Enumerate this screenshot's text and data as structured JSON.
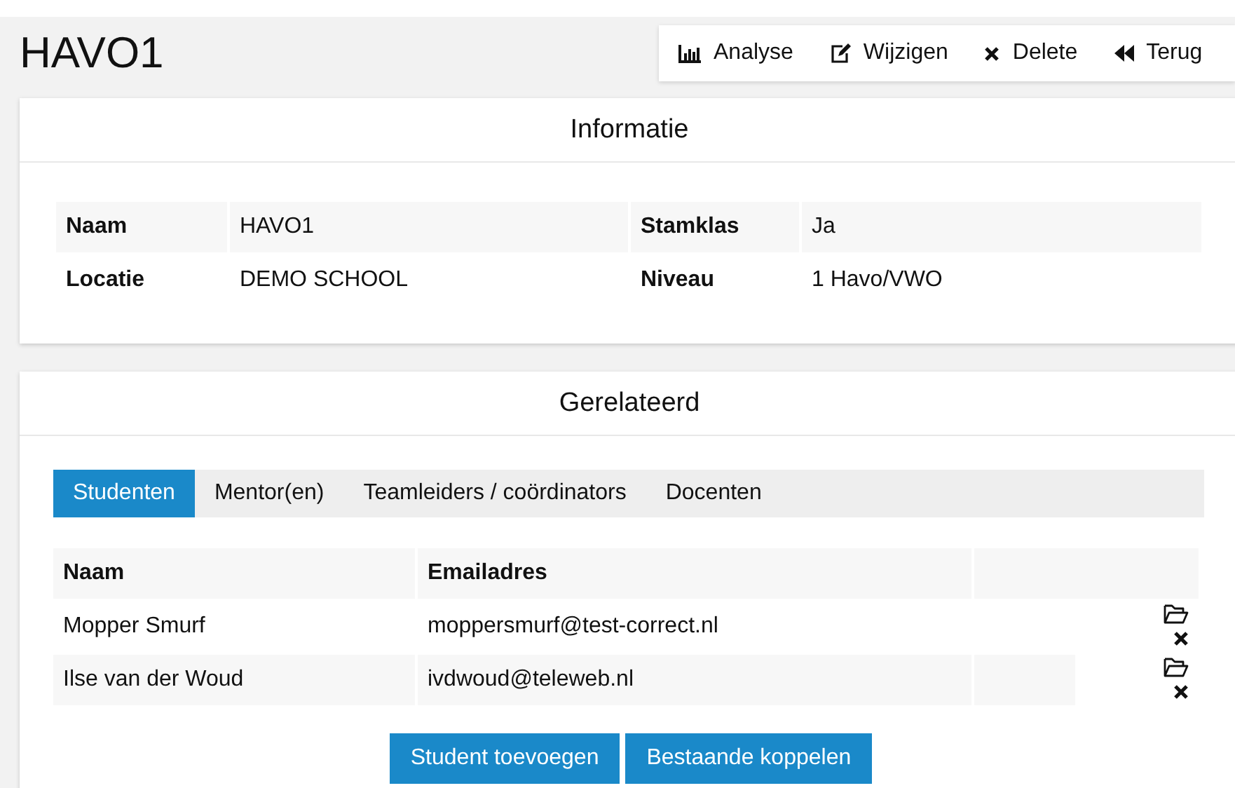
{
  "title": "HAVO1",
  "toolbar": [
    {
      "kind": "chart",
      "label": "Analyse"
    },
    {
      "kind": "edit",
      "label": "Wijzigen"
    },
    {
      "kind": "delete",
      "label": "Delete"
    },
    {
      "kind": "back",
      "label": "Terug"
    }
  ],
  "info": {
    "title": "Informatie",
    "rows": [
      [
        {
          "label": "Naam",
          "value": "HAVO1"
        },
        {
          "label": "Stamklas",
          "value": "Ja"
        }
      ],
      [
        {
          "label": "Locatie",
          "value": "DEMO SCHOOL"
        },
        {
          "label": "Niveau",
          "value": "1 Havo/VWO"
        }
      ]
    ]
  },
  "related": {
    "title": "Gerelateerd",
    "tabs": [
      {
        "label": "Studenten",
        "selected": true
      },
      {
        "label": "Mentor(en)",
        "selected": false
      },
      {
        "label": "Teamleiders / coördinators",
        "selected": false
      },
      {
        "label": "Docenten",
        "selected": false
      }
    ],
    "columns": [
      "Naam",
      "Emailadres"
    ],
    "rows": [
      {
        "name": "Mopper Smurf",
        "email": "moppersmurf@test-correct.nl"
      },
      {
        "name": "Ilse van der Woud",
        "email": "ivdwoud@teleweb.nl"
      }
    ],
    "buttons": [
      "Student toevoegen",
      "Bestaande koppelen"
    ]
  }
}
